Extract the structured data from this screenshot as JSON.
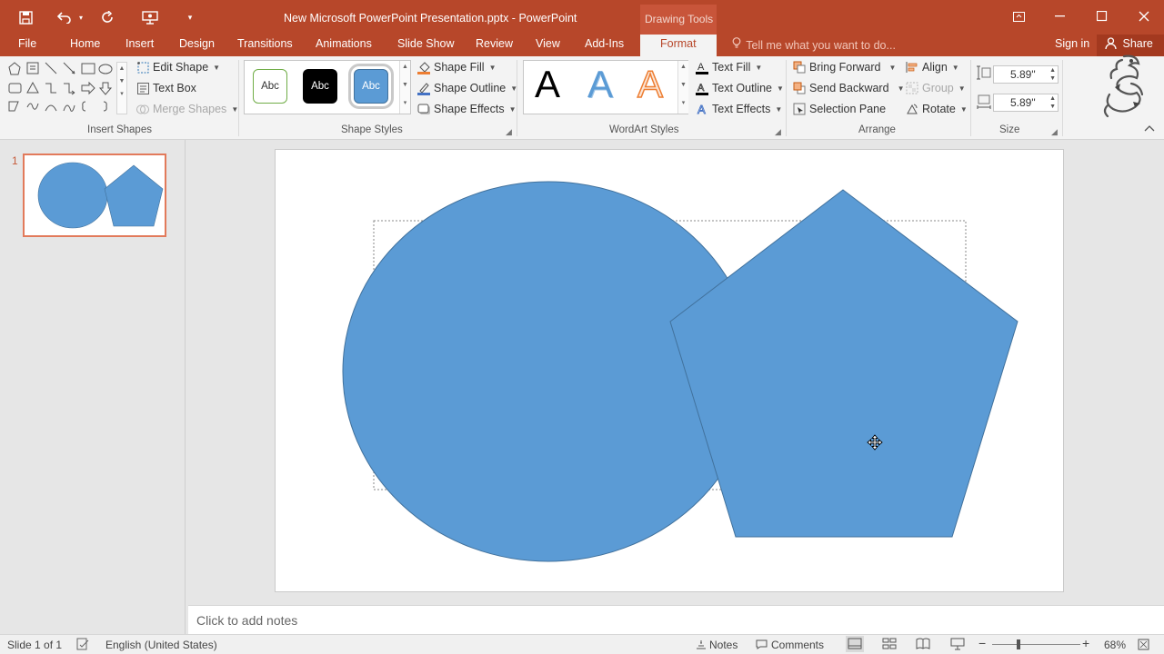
{
  "window": {
    "title": "New Microsoft PowerPoint Presentation.pptx - PowerPoint",
    "context_group": "Drawing Tools",
    "qat": [
      "save-icon",
      "undo-icon",
      "redo-icon",
      "present-from-start-icon",
      "customize-qat-icon"
    ]
  },
  "tabs": [
    "File",
    "Home",
    "Insert",
    "Design",
    "Transitions",
    "Animations",
    "Slide Show",
    "Review",
    "View",
    "Add-Ins",
    "Format"
  ],
  "active_tab": "Format",
  "tell_me": "Tell me what you want to do...",
  "sign_in": "Sign in",
  "share": "Share",
  "ribbon": {
    "insert_shapes": {
      "label": "Insert Shapes",
      "edit_shape": "Edit Shape",
      "text_box": "Text Box",
      "merge_shapes": "Merge Shapes"
    },
    "shape_styles": {
      "label": "Shape Styles",
      "thumbs": [
        "Abc",
        "Abc",
        "Abc"
      ],
      "shape_fill": "Shape Fill",
      "shape_outline": "Shape Outline",
      "shape_effects": "Shape Effects"
    },
    "wordart": {
      "label": "WordArt Styles",
      "letters": [
        "A",
        "A",
        "A"
      ],
      "text_fill": "Text Fill",
      "text_outline": "Text Outline",
      "text_effects": "Text Effects"
    },
    "arrange": {
      "label": "Arrange",
      "bring_forward": "Bring Forward",
      "send_backward": "Send Backward",
      "selection_pane": "Selection Pane",
      "align": "Align",
      "group": "Group",
      "rotate": "Rotate"
    },
    "size": {
      "label": "Size",
      "height": "5.89\"",
      "width": "5.89\""
    }
  },
  "slides_pane": {
    "number": "1"
  },
  "notes": {
    "placeholder": "Click to add notes"
  },
  "status": {
    "slide": "Slide 1 of 1",
    "language": "English (United States)",
    "notes": "Notes",
    "comments": "Comments",
    "zoom": "68%"
  },
  "colors": {
    "accent": "#b7472a",
    "shape_fill": "#5b9bd5",
    "shape_outline": "#41719c"
  }
}
